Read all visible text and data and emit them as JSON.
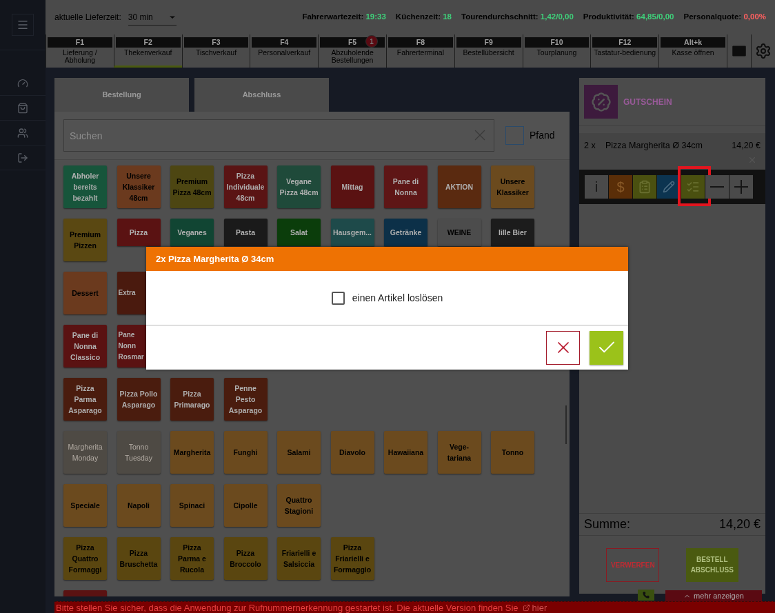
{
  "topbar": {
    "delivery_label": "aktuelle Lieferzeit:",
    "delivery_value": "30 min",
    "stats": [
      {
        "label": "Fahrerwartezeit:",
        "value": "19:33",
        "color": "#3fd07a"
      },
      {
        "label": "Küchenzeit:",
        "value": "18",
        "color": "#3fd07a"
      },
      {
        "label": "Tourendurchschnitt:",
        "value": "1,42/0,00",
        "color": "#3fd07a"
      },
      {
        "label": "Produktivität:",
        "value": "64,85/0,00",
        "color": "#3fd07a"
      },
      {
        "label": "Personalquote:",
        "value": "0,00%",
        "color": "#ff6060"
      }
    ]
  },
  "function_keys": [
    {
      "key": "F1",
      "label": "Lieferung / Abholung",
      "selected": false
    },
    {
      "key": "F2",
      "label": "Thekenverkauf",
      "selected": true
    },
    {
      "key": "F3",
      "label": "Tischverkauf",
      "selected": false
    },
    {
      "key": "F4",
      "label": "Personalverkauf",
      "selected": false
    },
    {
      "key": "F5",
      "label": "Abzuholende Bestellungen",
      "selected": false,
      "badge": "1"
    },
    {
      "key": "F8",
      "label": "Fahrerterminal",
      "selected": false
    },
    {
      "key": "F9",
      "label": "Bestellübersicht",
      "selected": false
    },
    {
      "key": "F10",
      "label": "Tourplanung",
      "selected": false
    },
    {
      "key": "F12",
      "label": "Tastatur-bedienung",
      "selected": false
    },
    {
      "key": "Alt+k",
      "label": "Kasse öffnen",
      "selected": false
    }
  ],
  "tabs": [
    {
      "label": "Bestellung"
    },
    {
      "label": "Abschluss"
    }
  ],
  "search": {
    "placeholder": "Suchen"
  },
  "pfand": {
    "label": "Pfand",
    "checked": false
  },
  "tile_rows": [
    [
      {
        "label": "Abholer bereits bezahlt",
        "color": "#17553b",
        "kind": "full",
        "dark_label": false,
        "disabled": false
      },
      {
        "label": "Unsere Klassiker 48cm",
        "color": "#6b3a1e",
        "kind": "full",
        "dark_label": true,
        "disabled": false
      },
      {
        "label": "Premium Pizza 48cm",
        "color": "#4d4612",
        "kind": "full",
        "dark_label": true,
        "disabled": false
      },
      {
        "label": "Pizza Individuale 48cm",
        "color": "#5a1414",
        "kind": "full",
        "dark_label": false,
        "disabled": false
      },
      {
        "label": "Vegane Pizza 48cm",
        "color": "#1f4a3a",
        "kind": "full",
        "dark_label": false,
        "disabled": false
      },
      {
        "label": "Mittag",
        "color": "#5a1212",
        "kind": "full",
        "dark_label": false,
        "disabled": false
      },
      {
        "label": "Pane di Nonna",
        "color": "#5e1616",
        "kind": "full",
        "dark_label": false,
        "disabled": false
      },
      {
        "label": "AKTION",
        "color": "#5a2a10",
        "kind": "full",
        "dark_label": false,
        "disabled": false
      },
      {
        "label": "Unsere Klassiker",
        "color": "#6b4a1e",
        "kind": "full",
        "dark_label": true,
        "disabled": false
      }
    ],
    [
      {
        "label": "Premium Pizzen",
        "color": "#5a4812",
        "kind": "full",
        "dark_label": true,
        "disabled": false
      },
      {
        "label": "Pizza",
        "color": "#5a1212",
        "kind": "cut_bottom",
        "dark_label": false,
        "disabled": false
      },
      {
        "label": "Veganes",
        "color": "#114533",
        "kind": "cut_bottom",
        "dark_label": false,
        "disabled": false
      },
      {
        "label": "Pasta",
        "color": "#1a1a1a",
        "kind": "cut_bottom",
        "dark_label": false,
        "disabled": false
      },
      {
        "label": "Salat",
        "color": "#0b3d0b",
        "kind": "cut_bottom",
        "dark_label": false,
        "disabled": false
      },
      {
        "label": "Hausgem...",
        "color": "#1e4a4a",
        "kind": "cut_bottom",
        "dark_label": false,
        "disabled": false
      },
      {
        "label": "Getränke",
        "color": "#0c3048",
        "kind": "cut_bottom",
        "dark_label": false,
        "disabled": false
      },
      {
        "label": "WEINE",
        "color": "#4c4c4c",
        "kind": "cut_bottom",
        "dark_label": true,
        "disabled": false
      },
      {
        "label": "lille Bier",
        "color": "#1c1c1c",
        "kind": "cut_bottom",
        "dark_label": false,
        "disabled": false
      }
    ],
    [
      {
        "label": "Dessert",
        "color": "#6b3a1e",
        "kind": "full",
        "dark_label": true,
        "disabled": false
      },
      {
        "label": "Extra",
        "color": "#4a1a0e",
        "kind": "cut_side",
        "dark_label": false,
        "disabled": false
      }
    ],
    [
      {
        "label": "Pane di Nonna Classico",
        "color": "#5a1212",
        "kind": "full",
        "dark_label": false,
        "disabled": false
      },
      {
        "label": "Pane Nonn Rosmar",
        "color": "#5a1212",
        "kind": "cut_side",
        "dark_label": false,
        "disabled": false
      }
    ],
    [
      {
        "label": "Pizza Parma Asparago",
        "color": "#4a1c0e",
        "kind": "full",
        "dark_label": false,
        "disabled": false
      },
      {
        "label": "Pizza Pollo Asparago",
        "color": "#4a1c0e",
        "kind": "full",
        "dark_label": false,
        "disabled": false
      },
      {
        "label": "Pizza Primarago",
        "color": "#4a1c0e",
        "kind": "full",
        "dark_label": false,
        "disabled": false
      },
      {
        "label": "Penne Pesto Asparago",
        "color": "#4a1c0e",
        "kind": "full",
        "dark_label": false,
        "disabled": false
      }
    ],
    [
      {
        "label": "Margherita Monday",
        "color": "#4e4a44",
        "kind": "full",
        "dark_label": false,
        "disabled": true
      },
      {
        "label": "Tonno Tuesday",
        "color": "#4e4a44",
        "kind": "full",
        "dark_label": false,
        "disabled": true
      },
      {
        "label": "Margherita",
        "color": "#6b4a1e",
        "kind": "full",
        "dark_label": true,
        "disabled": false
      },
      {
        "label": "Funghi",
        "color": "#6b4a1e",
        "kind": "full",
        "dark_label": true,
        "disabled": false
      },
      {
        "label": "Salami",
        "color": "#6b4a1e",
        "kind": "full",
        "dark_label": true,
        "disabled": false
      },
      {
        "label": "Diavolo",
        "color": "#6b4a1e",
        "kind": "full",
        "dark_label": true,
        "disabled": false
      },
      {
        "label": "Hawaiiana",
        "color": "#6b4a1e",
        "kind": "full",
        "dark_label": true,
        "disabled": false
      },
      {
        "label": "Vege-tariana",
        "color": "#6b4a1e",
        "kind": "full",
        "dark_label": true,
        "disabled": false
      },
      {
        "label": "Tonno",
        "color": "#6b4a1e",
        "kind": "full",
        "dark_label": true,
        "disabled": false
      }
    ],
    [
      {
        "label": "Speciale",
        "color": "#6b4a1e",
        "kind": "full",
        "dark_label": true,
        "disabled": false
      },
      {
        "label": "Napoli",
        "color": "#6b4a1e",
        "kind": "full",
        "dark_label": true,
        "disabled": false
      },
      {
        "label": "Spinaci",
        "color": "#6b4a1e",
        "kind": "full",
        "dark_label": true,
        "disabled": false
      },
      {
        "label": "Cipolle",
        "color": "#6b4a1e",
        "kind": "full",
        "dark_label": true,
        "disabled": false
      },
      {
        "label": "Quattro Stagioni",
        "color": "#6b4a1e",
        "kind": "full",
        "dark_label": true,
        "disabled": false
      }
    ],
    [
      {
        "label": "Pizza Quattro Formaggi",
        "color": "#5a4610",
        "kind": "full",
        "dark_label": true,
        "disabled": false
      },
      {
        "label": "Pizza Bruschetta",
        "color": "#5a4610",
        "kind": "full",
        "dark_label": true,
        "disabled": false
      },
      {
        "label": "Pizza Parma e Rucola",
        "color": "#5a4610",
        "kind": "full",
        "dark_label": true,
        "disabled": false
      },
      {
        "label": "Pizza Broccolo",
        "color": "#5a4610",
        "kind": "full",
        "dark_label": true,
        "disabled": false
      },
      {
        "label": "Friarielli e Salsiccia",
        "color": "#5a4610",
        "kind": "full",
        "dark_label": true,
        "disabled": false
      },
      {
        "label": "Pizza Friarielli e Formaggio",
        "color": "#5a4610",
        "kind": "full",
        "dark_label": true,
        "disabled": false
      }
    ],
    [
      {
        "color": "#5a1212",
        "kind": "full"
      }
    ]
  ],
  "voucher": {
    "label": "GUTSCHEIN"
  },
  "order_item": {
    "qty": "2 x",
    "name": "Pizza Margherita Ø 34cm",
    "price": "14,20 €"
  },
  "item_actions": [
    {
      "kind": "info",
      "label": "i",
      "highlighted": false
    },
    {
      "kind": "price",
      "label": "$",
      "highlighted": false
    },
    {
      "kind": "notes",
      "highlighted": false
    },
    {
      "kind": "edit",
      "highlighted": false
    },
    {
      "kind": "split",
      "highlighted": true
    },
    {
      "kind": "minus",
      "highlighted": false
    },
    {
      "kind": "plus",
      "highlighted": false
    }
  ],
  "total": {
    "label": "Summe:",
    "value": "14,20 €"
  },
  "actions": {
    "discard": "VERWERFEN",
    "checkout": "BESTELL ABSCHLUSS"
  },
  "more": "mehr anzeigen",
  "banner": {
    "text": "Bitte stellen Sie sicher, dass die Anwendung zur Rufnummernerkennung gestartet ist. Die aktuelle Version finden Sie",
    "link": "hier"
  },
  "dialog": {
    "title": "2x Pizza Margherita Ø 34cm",
    "option": {
      "label": "einen Artikel loslösen",
      "checked": false
    }
  }
}
